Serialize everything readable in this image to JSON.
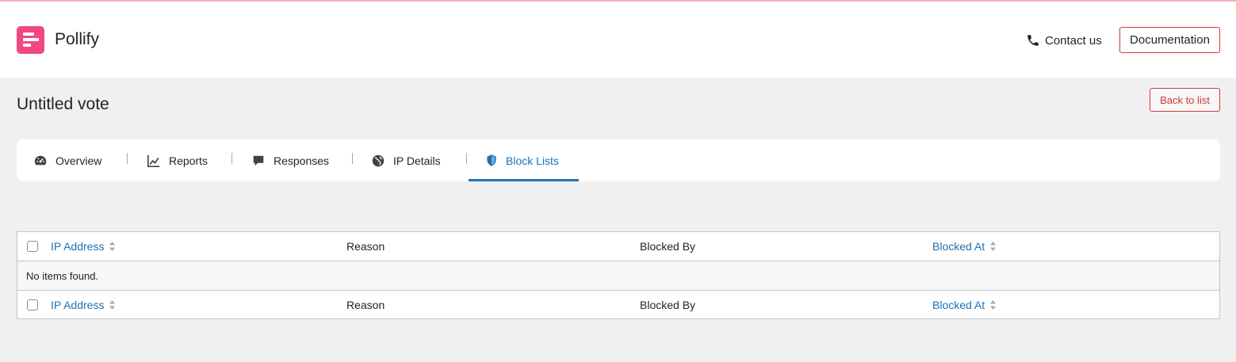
{
  "app": {
    "brand": "Pollify",
    "contact_label": "Contact us",
    "documentation_label": "Documentation",
    "accent_color": "#f2487e",
    "link_color": "#2271b1",
    "danger_color": "#d63638"
  },
  "page": {
    "title": "Untitled vote",
    "back_label": "Back to list"
  },
  "tabs": [
    {
      "label": "Overview",
      "icon": "dashboard-icon",
      "active": false
    },
    {
      "label": "Reports",
      "icon": "chart-line-icon",
      "active": false
    },
    {
      "label": "Responses",
      "icon": "comment-icon",
      "active": false
    },
    {
      "label": "IP Details",
      "icon": "globe-icon",
      "active": false
    },
    {
      "label": "Block Lists",
      "icon": "shield-icon",
      "active": true
    }
  ],
  "table": {
    "columns": [
      "IP Address",
      "Reason",
      "Blocked By",
      "Blocked At"
    ],
    "empty_message": "No items found."
  }
}
